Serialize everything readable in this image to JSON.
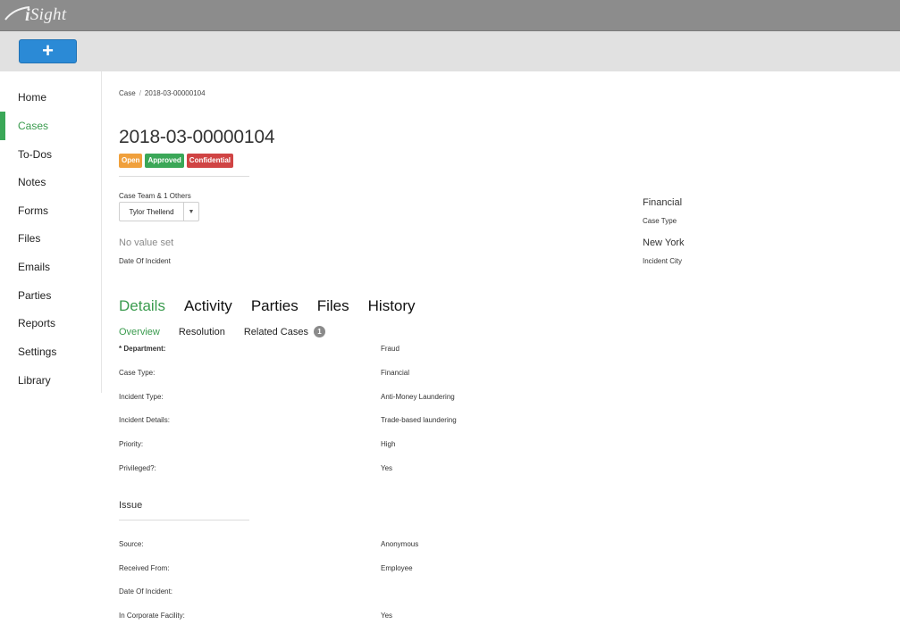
{
  "app": {
    "logo_text": "Sight"
  },
  "toolbar": {
    "add_label": "+"
  },
  "sidebar": {
    "items": [
      {
        "label": "Home"
      },
      {
        "label": "Cases"
      },
      {
        "label": "To-Dos"
      },
      {
        "label": "Notes"
      },
      {
        "label": "Forms"
      },
      {
        "label": "Files"
      },
      {
        "label": "Emails"
      },
      {
        "label": "Parties"
      },
      {
        "label": "Reports"
      },
      {
        "label": "Settings"
      },
      {
        "label": "Library"
      }
    ],
    "active": "Cases"
  },
  "breadcrumb": {
    "parent": "Case",
    "separator": "/",
    "current": "2018-03-00000104"
  },
  "case": {
    "number": "2018-03-00000104",
    "badges": {
      "open": "Open",
      "approved": "Approved",
      "confidential": "Confidential"
    },
    "team_label": "Case Team & 1 Others",
    "assignee": "Tylor Thellend",
    "date_of_incident_value": "No value set",
    "date_of_incident_label": "Date Of Incident",
    "case_type_value": "Financial",
    "case_type_label": "Case Type",
    "incident_city_value": "New York",
    "incident_city_label": "Incident City"
  },
  "tabs": [
    "Details",
    "Activity",
    "Parties",
    "Files",
    "History"
  ],
  "subtabs": {
    "overview": "Overview",
    "resolution": "Resolution",
    "related": "Related Cases",
    "related_count": "1"
  },
  "details": [
    {
      "label": "* Department:",
      "value": "Fraud"
    },
    {
      "label": "Case Type:",
      "value": "Financial"
    },
    {
      "label": "Incident Type:",
      "value": "Anti-Money Laundering"
    },
    {
      "label": "Incident Details:",
      "value": "Trade-based laundering"
    },
    {
      "label": "Priority:",
      "value": "High"
    },
    {
      "label": "Privileged?:",
      "value": "Yes"
    }
  ],
  "issue": {
    "title": "Issue",
    "rows": [
      {
        "label": "Source:",
        "value": "Anonymous"
      },
      {
        "label": "Received From:",
        "value": "Employee"
      },
      {
        "label": "Date Of Incident:",
        "value": ""
      },
      {
        "label": "In Corporate Facility:",
        "value": "Yes"
      }
    ]
  },
  "colors": {
    "accent_green": "#3aa757",
    "primary_blue": "#2b8ad6",
    "badge_open": "#f0a03c",
    "badge_confidential": "#d04444",
    "topbar": "#8c8c8c"
  }
}
